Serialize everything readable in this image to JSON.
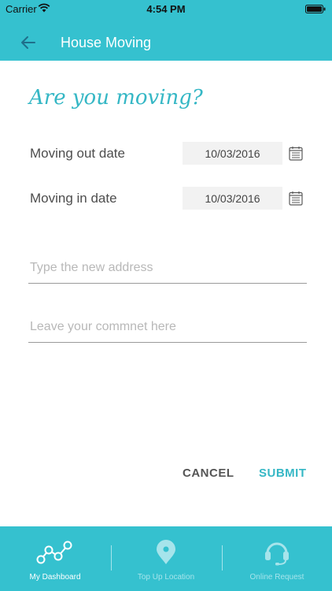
{
  "status_bar": {
    "carrier": "Carrier",
    "time": "4:54 PM"
  },
  "app_bar": {
    "title": "House Moving",
    "back_icon": "arrow-left-icon"
  },
  "form": {
    "question": "Are you moving?",
    "moving_out": {
      "label": "Moving out date",
      "value": "10/03/2016"
    },
    "moving_in": {
      "label": "Moving in date",
      "value": "10/03/2016"
    },
    "address_placeholder": "Type the new address",
    "comment_placeholder": "Leave your commnet here"
  },
  "actions": {
    "cancel": "CANCEL",
    "submit": "SUBMIT"
  },
  "tabs": [
    {
      "label": "My Dashboard",
      "icon": "dashboard-graph-icon",
      "active": true
    },
    {
      "label": "Top Up Location",
      "icon": "location-pin-icon",
      "active": false
    },
    {
      "label": "Online Request",
      "icon": "headset-icon",
      "active": false
    }
  ],
  "colors": {
    "primary": "#35c1cf",
    "accent": "#35b7c5",
    "inactive_tab": "#a6e4eb"
  }
}
